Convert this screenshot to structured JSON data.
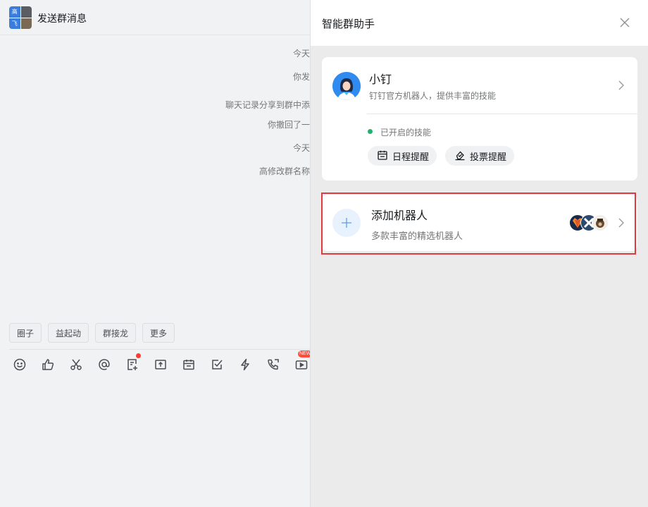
{
  "chat": {
    "title": "发送群消息",
    "avatar_chars": [
      "高",
      "",
      "飞",
      ""
    ],
    "system_messages": [
      "今天",
      "你发",
      "聊天记录分享到群中添",
      "你撤回了一",
      "今天",
      "高修改群名称"
    ],
    "quick_actions": [
      "圈子",
      "益起动",
      "群接龙",
      "更多"
    ],
    "toolbar": [
      {
        "icon": "emoji-icon"
      },
      {
        "icon": "thumbs-up-icon"
      },
      {
        "icon": "scissors-icon"
      },
      {
        "icon": "at-icon"
      },
      {
        "icon": "doc-add-icon",
        "badge": "dot"
      },
      {
        "icon": "upload-folder-icon"
      },
      {
        "icon": "calendar-icon"
      },
      {
        "icon": "checkbox-icon"
      },
      {
        "icon": "lightning-icon"
      },
      {
        "icon": "phone-icon"
      },
      {
        "icon": "video-icon",
        "badge": "NEW"
      }
    ]
  },
  "panel": {
    "title": "智能群助手",
    "close_icon": "close-icon",
    "bot": {
      "name": "小钉",
      "description": "钉钉官方机器人，提供丰富的技能",
      "status_label": "已开启的技能",
      "status_color": "#23b26d",
      "skills": [
        {
          "label": "日程提醒",
          "icon": "calendar-icon"
        },
        {
          "label": "投票提醒",
          "icon": "vote-icon"
        }
      ]
    },
    "add_robot": {
      "title": "添加机器人",
      "description": "多款丰富的精选机器人",
      "highlight_color": "#e0393e"
    }
  },
  "colors": {
    "accent": "#2f8bf0",
    "status_green": "#23b26d",
    "new_badge": "#ff4d3d"
  }
}
